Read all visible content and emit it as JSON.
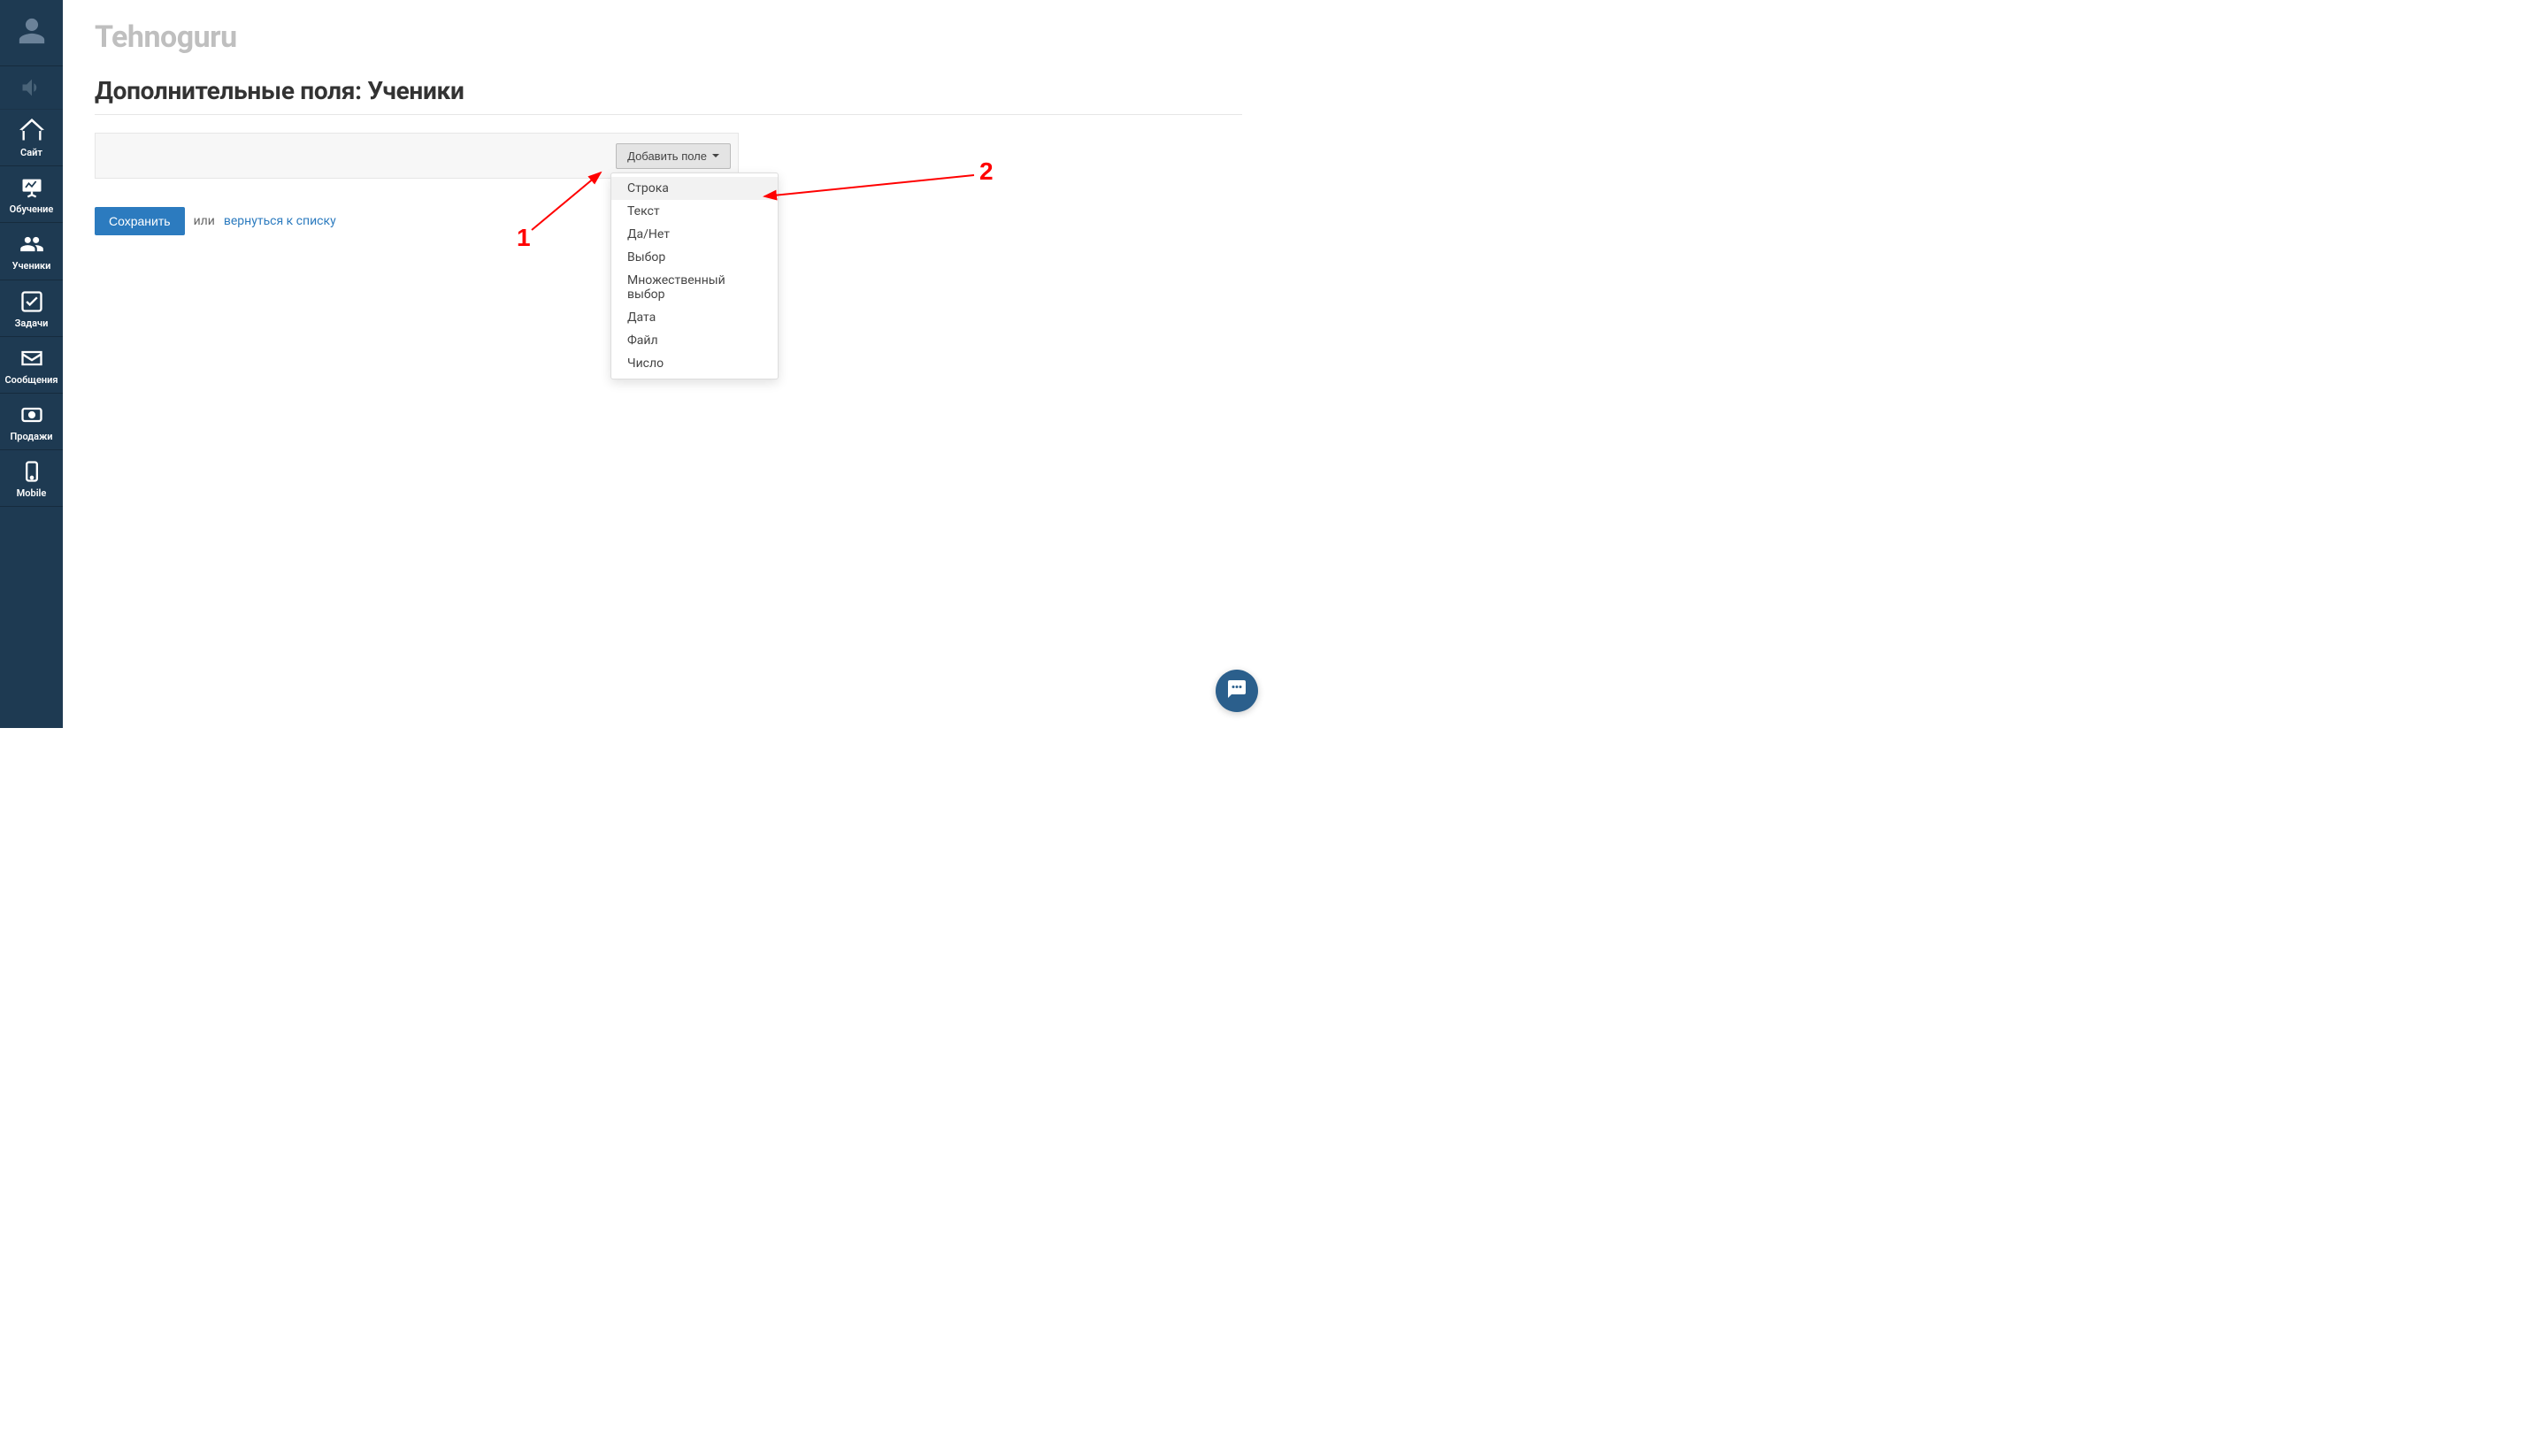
{
  "sidebar": {
    "items": [
      {
        "label": ""
      },
      {
        "label": ""
      },
      {
        "label": "Сайт"
      },
      {
        "label": "Обучение"
      },
      {
        "label": "Ученики"
      },
      {
        "label": "Задачи"
      },
      {
        "label": "Сообщения"
      },
      {
        "label": "Продажи"
      },
      {
        "label": "Mobile"
      }
    ]
  },
  "header": {
    "app_title": "Tehnoguru",
    "page_title": "Дополнительные поля: Ученики"
  },
  "panel": {
    "add_field_label": "Добавить поле"
  },
  "dropdown": {
    "items": [
      "Строка",
      "Текст",
      "Да/Нет",
      "Выбор",
      "Множественный выбор",
      "Дата",
      "Файл",
      "Число"
    ]
  },
  "actions": {
    "save_label": "Сохранить",
    "or_text": "или",
    "return_label": "вернуться к списку"
  },
  "annotations": {
    "label1": "1",
    "label2": "2"
  }
}
